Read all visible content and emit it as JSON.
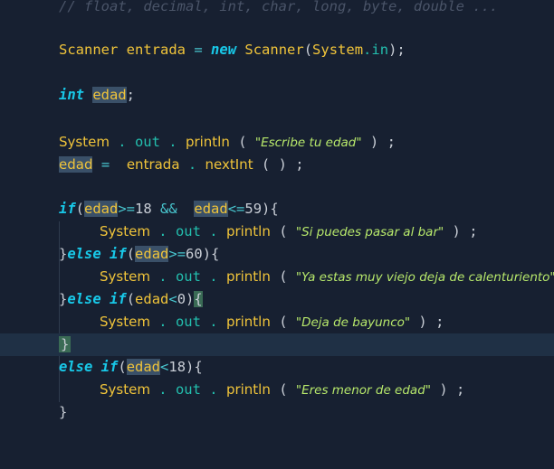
{
  "editor": {
    "comment": "// float, decimal, int, char, long, byte, double ...",
    "kw_new": "new",
    "kw_int": "int",
    "kw_if": "if",
    "kw_else": "else",
    "cls_scanner": "Scanner",
    "var_entrada": "entrada",
    "var_edad": "edad",
    "cls_system": "System",
    "fld_in": "in",
    "fld_out": "out",
    "mth_println": "println",
    "mth_nextint": "nextInt",
    "op_assign": "=",
    "op_and": "&&",
    "op_ge": ">=",
    "op_le": "<=",
    "op_lt": "<",
    "num_18": "18",
    "num_59": "59",
    "num_60": "60",
    "num_0": "0",
    "str_1": "\"Escribe tu edad\"",
    "str_2": "\"Si puedes pasar al bar\"",
    "str_3": "\"Ya estas muy viejo deja de calenturiento\"",
    "str_4": "\"Deja de bayunco\"",
    "str_5": "\"Eres menor de edad\""
  }
}
